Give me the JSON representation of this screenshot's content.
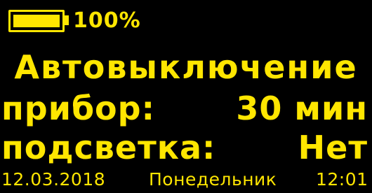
{
  "colors": {
    "background": "#000000",
    "foreground": "#FFE600"
  },
  "status": {
    "battery_icon": "battery-full-icon",
    "battery_level_fraction": 1.0,
    "battery_percent": "100%"
  },
  "screen": {
    "title": "Автовыключение",
    "rows": [
      {
        "label": "прибор:",
        "value": "30 мин"
      },
      {
        "label": "подсветка:",
        "value": "Нет"
      }
    ]
  },
  "footer": {
    "date": "12.03.2018",
    "weekday": "Понедельник",
    "time": "12:01"
  }
}
